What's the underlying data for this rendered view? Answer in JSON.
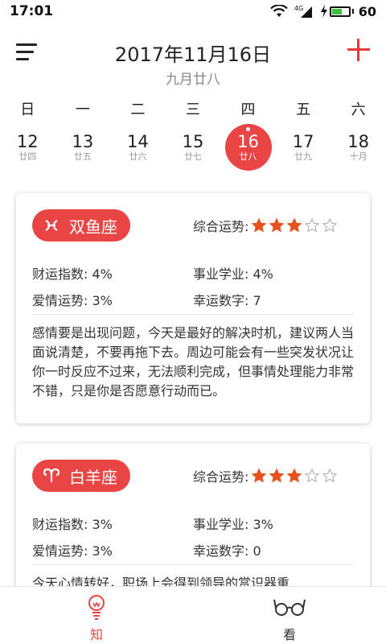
{
  "status_bar": {
    "time": "17:01",
    "network": "4G",
    "battery": "60",
    "battery_level": 0.6
  },
  "header": {
    "date": "2017年11月16日",
    "lunar": "九月廿八"
  },
  "week": {
    "weekdays": [
      "日",
      "一",
      "二",
      "三",
      "四",
      "五",
      "六"
    ],
    "days": [
      {
        "num": "12",
        "lunar": "廿四"
      },
      {
        "num": "13",
        "lunar": "廿五"
      },
      {
        "num": "14",
        "lunar": "廿六"
      },
      {
        "num": "15",
        "lunar": "廿七"
      },
      {
        "num": "16",
        "lunar": "廿八"
      },
      {
        "num": "17",
        "lunar": "廿九"
      },
      {
        "num": "18",
        "lunar": "十月"
      }
    ],
    "selected_index": 4
  },
  "cards": [
    {
      "sign": "双鱼座",
      "icon": "pisces-icon",
      "overall_label": "综合运势:",
      "stars_filled": 3,
      "stars_total": 5,
      "wealth": "财运指数:  4%",
      "career": "事业学业:  4%",
      "love": "爱情运势:  3%",
      "lucky": "幸运数字:  7",
      "description": "感情要是出现问题，今天是最好的解决时机，建议两人当面说清楚，不要再拖下去。周边可能会有一些突发状况让你一时反应不过来，无法顺利完成，但事情处理能力非常不错，只是你是否愿意行动而已。"
    },
    {
      "sign": "白羊座",
      "icon": "aries-icon",
      "overall_label": "综合运势:",
      "stars_filled": 3,
      "stars_total": 5,
      "wealth": "财运指数:  3%",
      "career": "事业学业:  3%",
      "love": "爱情运势:  3%",
      "lucky": "幸运数字:  0",
      "description": "今天心情转好，职场上会得到领导的赏识器重"
    }
  ],
  "bottom_nav": [
    {
      "label": "知",
      "icon": "lightbulb-icon",
      "active": true
    },
    {
      "label": "看",
      "icon": "glasses-icon",
      "active": false
    }
  ],
  "colors": {
    "accent": "#e94545",
    "star": "#e8501e",
    "battery": "#3cc13c"
  }
}
